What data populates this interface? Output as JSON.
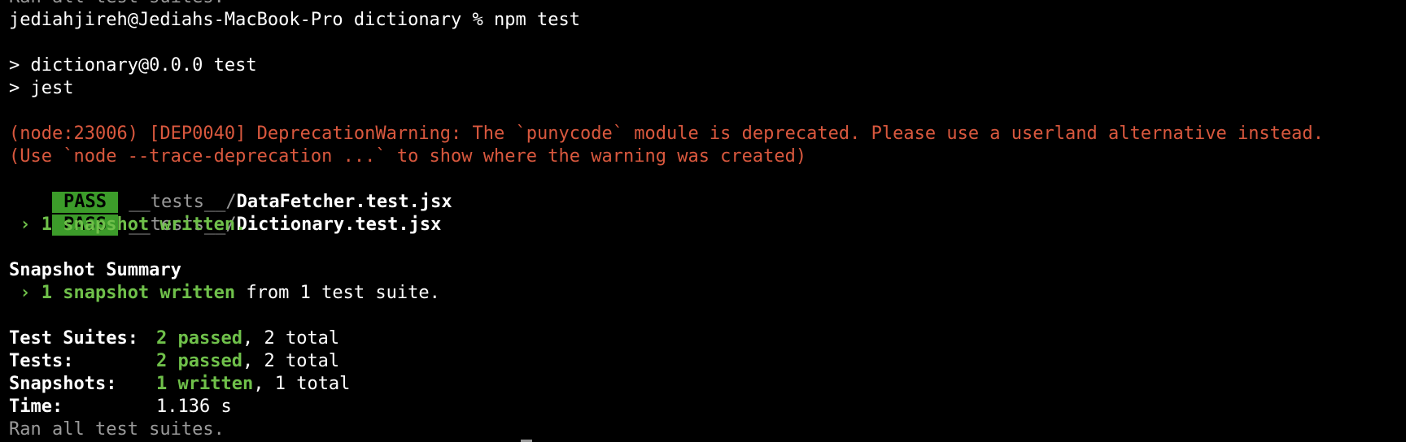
{
  "terminal": {
    "prev_ran": "Ran all test suites.",
    "prompt": "jediahjireh@Jediahs-MacBook-Pro dictionary % npm test",
    "script_line1": "> dictionary@0.0.0 test",
    "script_line2": "> jest",
    "warning_line1": "(node:23006) [DEP0040] DeprecationWarning: The `punycode` module is deprecated. Please use a userland alternative instead.",
    "warning_line2": "(Use `node --trace-deprecation ...` to show where the warning was created)",
    "results": [
      {
        "badge": "PASS",
        "dir": "__tests__/",
        "file": "DataFetcher.test.jsx"
      },
      {
        "badge": "PASS",
        "dir": "__tests__/",
        "file": "Dictionary.test.jsx"
      }
    ],
    "snapshot_note": " › 1 snapshot written.",
    "snapshot_summary_title": "Snapshot Summary",
    "snapshot_summary_green": " › 1 snapshot written",
    "snapshot_summary_rest": " from 1 test suite.",
    "stats": {
      "suites_label": "Test Suites:",
      "suites_green": "2 passed",
      "suites_rest": ", 2 total",
      "tests_label": "Tests:",
      "tests_green": "2 passed",
      "tests_rest": ", 2 total",
      "snapshots_label": "Snapshots:",
      "snapshots_green": "1 written",
      "snapshots_rest": ", 1 total",
      "time_label": "Time:",
      "time_value": "1.136 s"
    },
    "ran_all": "Ran all test suites."
  },
  "colors": {
    "background": "#000000",
    "text": "#ffffff",
    "dim": "#9a9a9a",
    "warning": "#d9583e",
    "green": "#6fc04a",
    "pass_badge": "#3c9c2a"
  }
}
